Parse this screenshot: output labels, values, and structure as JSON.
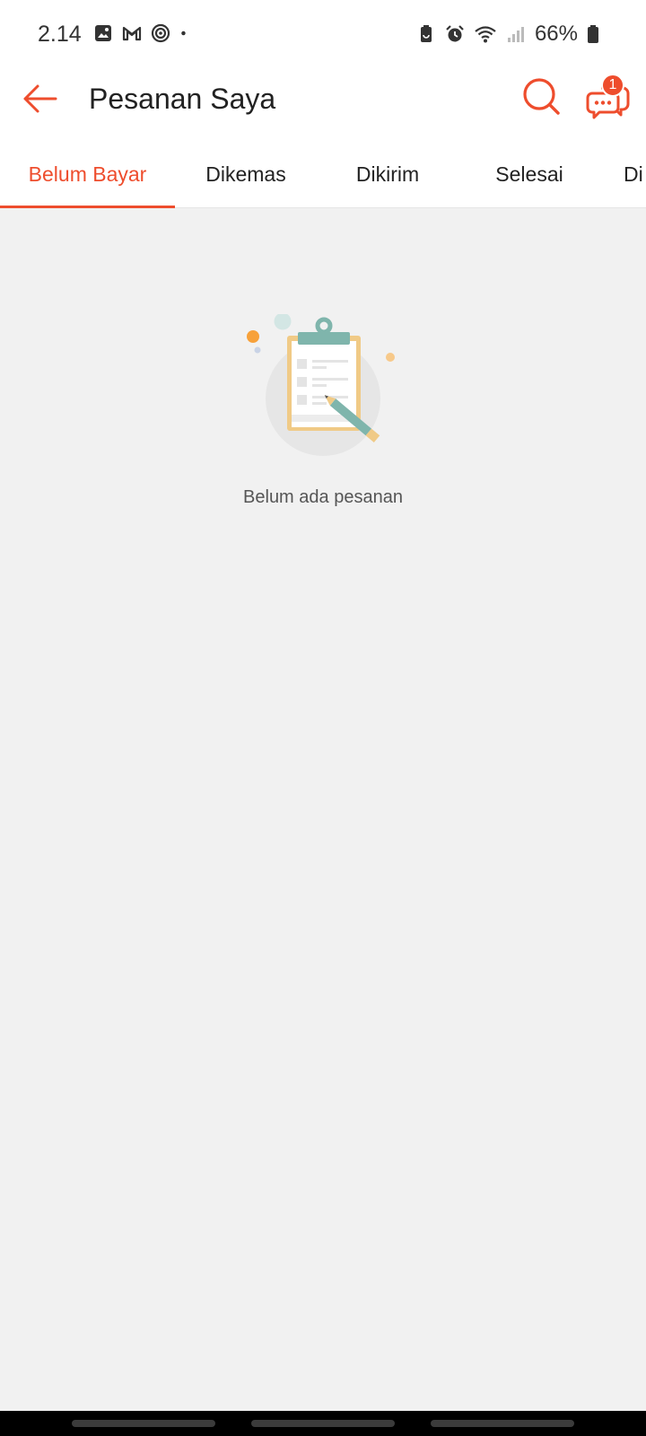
{
  "status_bar": {
    "time": "2.14",
    "battery_percent": "66%",
    "left_icons": [
      "gallery-icon",
      "gmail-icon",
      "target-icon",
      "dot-icon"
    ],
    "right_icons": [
      "battery-saver-icon",
      "alarm-icon",
      "wifi-icon",
      "signal-icon",
      "battery-icon"
    ]
  },
  "header": {
    "title": "Pesanan Saya",
    "chat_badge_count": "1"
  },
  "tabs": [
    {
      "label": "Belum Bayar",
      "active": true
    },
    {
      "label": "Dikemas",
      "active": false
    },
    {
      "label": "Dikirim",
      "active": false
    },
    {
      "label": "Selesai",
      "active": false
    },
    {
      "label": "Di",
      "active": false
    }
  ],
  "empty_state": {
    "message": "Belum ada pesanan"
  },
  "colors": {
    "accent": "#ee4d2d",
    "background": "#f1f1f1",
    "header_bg": "#ffffff"
  }
}
